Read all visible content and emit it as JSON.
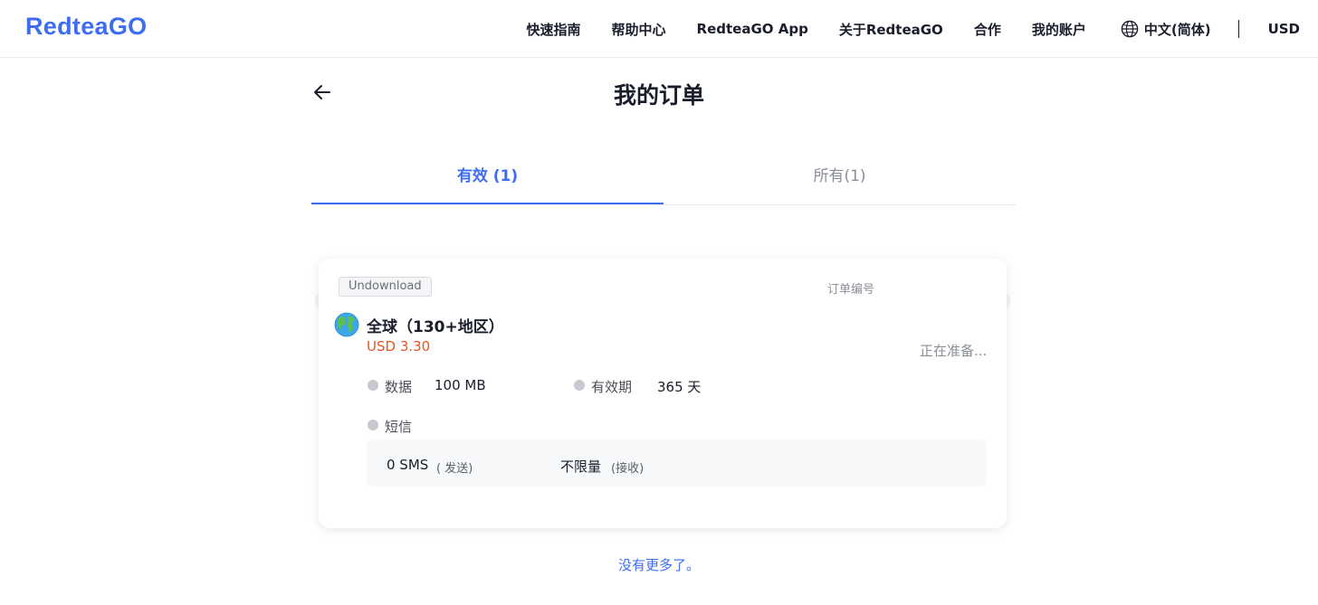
{
  "header": {
    "logo": "RedteaGO",
    "nav": [
      "快速指南",
      "帮助中心",
      "RedteaGO App",
      "关于RedteaGO",
      "合作",
      "我的账户"
    ],
    "language": "中文(简体)",
    "currency": "USD",
    "icons": {
      "language": "globe-icon"
    }
  },
  "page": {
    "title": "我的订单",
    "back_icon": "arrow-left-icon"
  },
  "tabs": [
    {
      "label": "有效 (1)",
      "active": true
    },
    {
      "label": "所有(1)",
      "active": false
    }
  ],
  "order": {
    "status_badge": "Undownload",
    "order_number_label": "订单编号",
    "plan_name": "全球（130+地区）",
    "price": "USD 3.30",
    "status_text": "正在准备...",
    "flag_icon": "globe-earth-icon",
    "data_label": "数据",
    "data_value": "100 MB",
    "validity_label": "有效期",
    "validity_value": "365 天",
    "sms_label": "短信",
    "sms_send_value": "0 SMS",
    "sms_send_note": "( 发送)",
    "sms_receive_value": "不限量",
    "sms_receive_note": "(接收)"
  },
  "footer": {
    "no_more": "没有更多了。"
  },
  "colors": {
    "accent": "#3f6df2",
    "price": "#e8531f",
    "muted": "#8a8e99"
  }
}
